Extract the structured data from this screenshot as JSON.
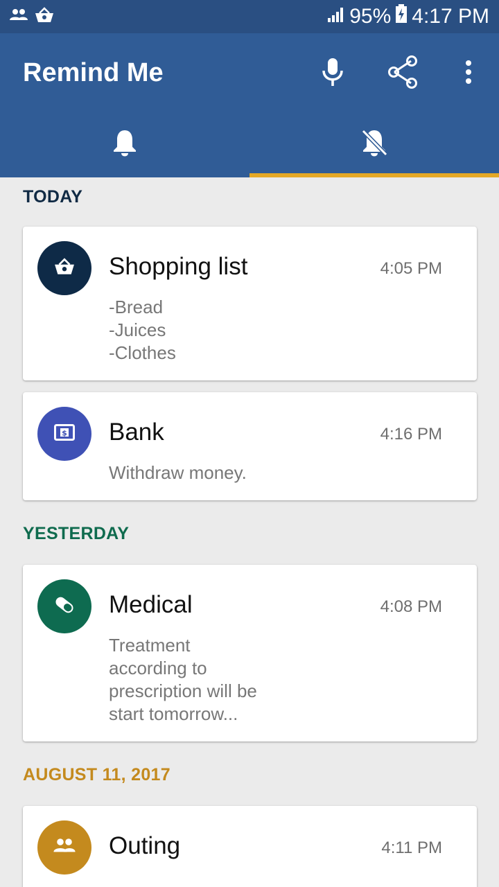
{
  "status_bar": {
    "battery": "95%",
    "time": "4:17 PM",
    "left_icons": [
      "people-icon",
      "basket-icon"
    ],
    "right_icons": [
      "signal-icon",
      "battery-charging-icon"
    ]
  },
  "app_bar": {
    "title": "Remind Me",
    "actions": [
      "microphone-icon",
      "share-icon",
      "more-vert-icon"
    ],
    "tabs": [
      {
        "icon": "bell-icon",
        "active": false
      },
      {
        "icon": "bell-off-icon",
        "active": true
      }
    ],
    "color": "#305c96",
    "indicator_color": "#e4a826"
  },
  "sections": [
    {
      "label": "TODAY",
      "color": "#102a44",
      "cards": [
        {
          "title": "Shopping list",
          "time": "4:05 PM",
          "icon": "basket-icon",
          "avatar_color": "#0e2a47",
          "note_lines": [
            "-Bread",
            "-Juices",
            "-Clothes"
          ]
        },
        {
          "title": "Bank",
          "time": "4:16 PM",
          "icon": "money-icon",
          "avatar_color": "#3f51b5",
          "note_lines": [
            "Withdraw money."
          ]
        }
      ]
    },
    {
      "label": "YESTERDAY",
      "color": "#0f6b4e",
      "cards": [
        {
          "title": "Medical",
          "time": "4:08 PM",
          "icon": "pill-icon",
          "avatar_color": "#0e6b50",
          "note_lines": [
            "Treatment",
            "according to",
            "prescription will be",
            "start tomorrow..."
          ]
        }
      ]
    },
    {
      "label": "AUGUST 11, 2017",
      "color": "#c48a1e",
      "cards": [
        {
          "title": "Outing",
          "time": "4:11 PM",
          "icon": "people-icon",
          "avatar_color": "#c48a1e",
          "note_lines": []
        }
      ]
    }
  ]
}
